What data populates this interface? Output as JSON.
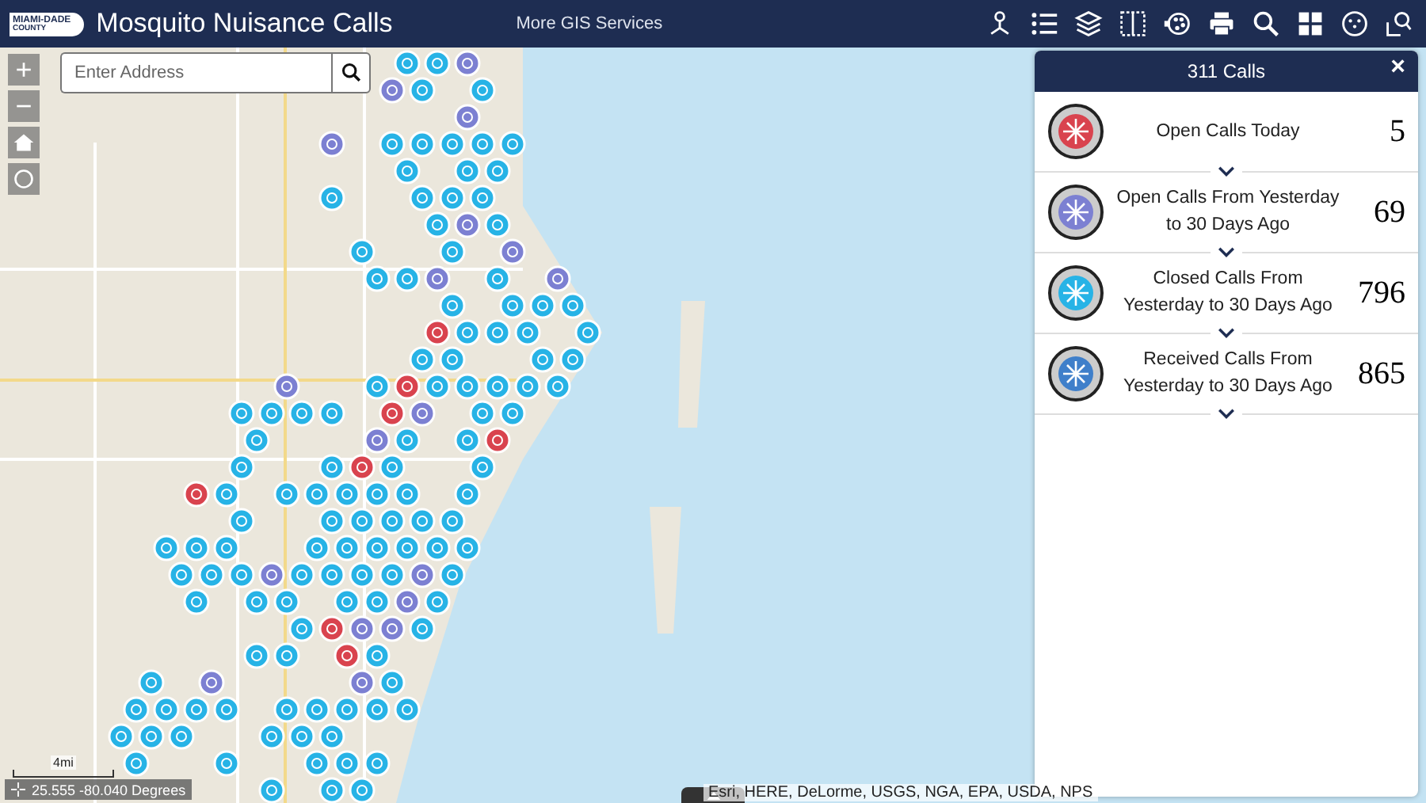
{
  "header": {
    "logo": {
      "line1": "MIAMI-DADE",
      "line2": "COUNTY"
    },
    "title": "Mosquito Nuisance Calls",
    "link": "More GIS Services"
  },
  "map_controls": {
    "zoom_in": "+",
    "zoom_out": "−"
  },
  "search": {
    "placeholder": "Enter Address"
  },
  "panel": {
    "title": "311 Calls",
    "close": "×",
    "rows": [
      {
        "label": "Open Calls Today",
        "count": "5",
        "color": "#d9434e"
      },
      {
        "label": "Open Calls From Yesterday to 30 Days Ago",
        "count": "69",
        "color": "#7c80d2"
      },
      {
        "label": "Closed Calls From Yesterday to 30 Days Ago",
        "count": "796",
        "color": "#27b3e6"
      },
      {
        "label": "Received Calls From Yesterday to 30 Days Ago",
        "count": "865",
        "color": "#3f7fca"
      }
    ]
  },
  "coordinates": "25.555 -80.040 Degrees",
  "scale": "4mi",
  "attribution": "Esri, HERE, DeLorme, USGS, NGA, EPA, USDA, NPS"
}
